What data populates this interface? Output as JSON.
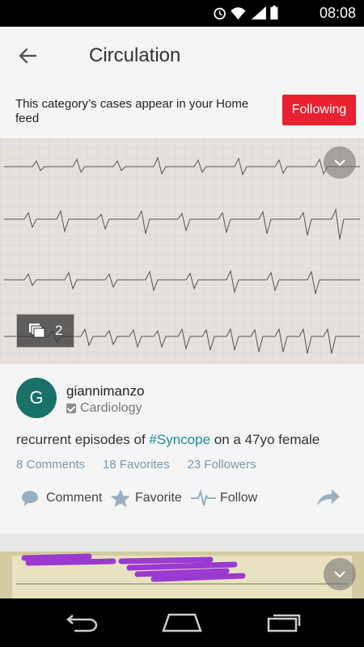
{
  "status": {
    "time": "08:08"
  },
  "header": {
    "title": "Circulation"
  },
  "follow": {
    "text": "This category’s cases appear in your Home feed",
    "button_label": "Following"
  },
  "case": {
    "image_count": "2",
    "author": {
      "initial": "G",
      "username": "giannimanzo",
      "category": "Cardiology"
    },
    "description_prefix": "recurrent episodes of ",
    "hashtag": "#Syncope",
    "description_suffix": " on a 47yo female",
    "stats": {
      "comments": "8 Comments",
      "favorites": "18 Favorites",
      "followers": "23 Followers"
    },
    "actions": {
      "comment": "Comment",
      "favorite": "Favorite",
      "follow": "Follow"
    }
  },
  "colors": {
    "accent": "#e8202f",
    "avatar": "#1a7169",
    "hashtag": "#1a8c98",
    "stats": "#7a9aae"
  }
}
